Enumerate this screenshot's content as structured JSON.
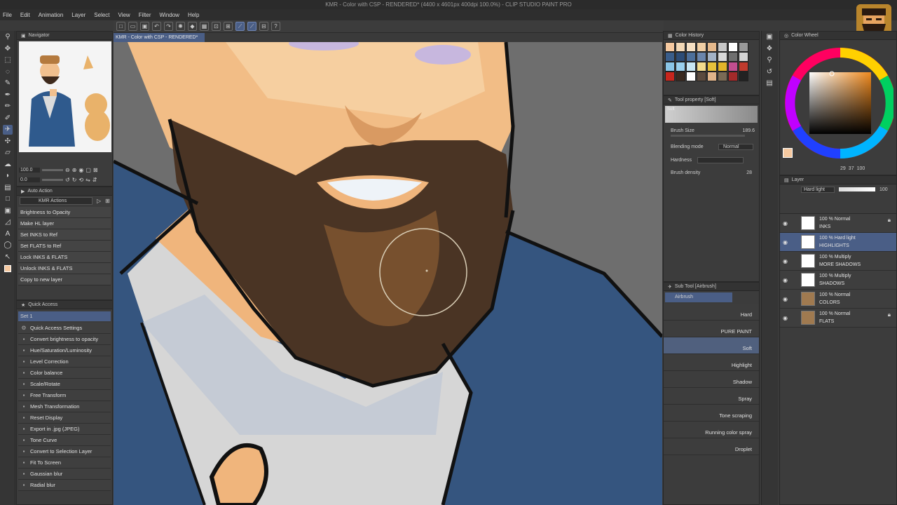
{
  "window": {
    "title": "KMR - Color with CSP - RENDERED* (4400 x 4601px 400dpi 100.0%) - CLIP STUDIO PAINT PRO"
  },
  "menu": [
    "File",
    "Edit",
    "Animation",
    "Layer",
    "Select",
    "View",
    "Filter",
    "Window",
    "Help"
  ],
  "document_tab": "KMR - Color with CSP - RENDERED*",
  "navigator": {
    "title": "Navigator",
    "zoom": "100.0",
    "rotation": "0.0"
  },
  "auto_action": {
    "title": "Auto Action",
    "set": "KMR Actions",
    "items": [
      "Brightness to Opacity",
      "Make HL layer",
      "Set INKS to Ref",
      "Set FLATS to Ref",
      "Lock INKS & FLATS",
      "Unlock INKS & FLATS",
      "Copy to new layer"
    ]
  },
  "quick_access": {
    "title": "Quick Access",
    "set": "Set 1",
    "items": [
      "Quick Access Settings",
      "Convert brightness to opacity",
      "Hue/Saturation/Luminosity",
      "Level Correction",
      "Color balance",
      "Scale/Rotate",
      "Free Transform",
      "Mesh Transformation",
      "Reset Display",
      "Export in .jpg (JPEG)",
      "Tone Curve",
      "Convert to Selection Layer",
      "Fit To Screen",
      "Gaussian blur",
      "Radial blur"
    ]
  },
  "color_history": {
    "title": "Color History",
    "colors": [
      "#f6c9a0",
      "#f3d8b6",
      "#f6e0c4",
      "#f1cfa5",
      "#e5b98c",
      "#c8c8c8",
      "#ffffff",
      "#9a9a9a",
      "#3a5d8a",
      "#2d4c76",
      "#4d6f9a",
      "#6b86ad",
      "#a3b2c6",
      "#d8d8d8",
      "#6f6f6f",
      "#d5d5d5",
      "#8ac5e6",
      "#9ad0ed",
      "#c7e6f3",
      "#f3dc8c",
      "#e6c13b",
      "#e2b42a",
      "#c14e8f",
      "#bf3b2e",
      "#c7261d",
      "#3a2a20",
      "#ffffff",
      "#5a4a3e",
      "#e0b48a",
      "#7a6a55",
      "#a32a2a",
      "#222222"
    ]
  },
  "tool_property": {
    "title": "Tool property [Soft]",
    "preset": "Soft",
    "brush_size_label": "Brush Size",
    "brush_size": "189.6",
    "blending_label": "Blending mode",
    "blending_value": "Normal",
    "hardness_label": "Hardness",
    "density_label": "Brush density",
    "density_value": "28"
  },
  "sub_tool": {
    "title": "Sub Tool [Airbrush]",
    "group": "Airbrush",
    "brushes": [
      "Hard",
      "PURE PAINT",
      "Soft",
      "Highlight",
      "Shadow",
      "Spray",
      "Tone scraping",
      "Running color spray",
      "Droplet"
    ],
    "selected": "Soft"
  },
  "color_wheel": {
    "title": "Color Wheel",
    "current": "#f6c9a0",
    "h": "29",
    "s": "37",
    "v": "100"
  },
  "layers": {
    "title": "Layer",
    "blend": "Hard light",
    "opacity": "100",
    "items": [
      {
        "mode": "100 % Normal",
        "name": "INKS",
        "locked": true,
        "selected": false
      },
      {
        "mode": "100 % Hard light",
        "name": "HIGHLIGHTS",
        "locked": false,
        "selected": true
      },
      {
        "mode": "100 % Multiply",
        "name": "MORE SHADOWS",
        "locked": false,
        "selected": false
      },
      {
        "mode": "100 % Multiply",
        "name": "SHADOWS",
        "locked": false,
        "selected": false
      },
      {
        "mode": "100 % Normal",
        "name": "COLORS",
        "locked": false,
        "selected": false
      },
      {
        "mode": "100 % Normal",
        "name": "FLATS",
        "locked": true,
        "selected": false
      }
    ]
  },
  "icons": [
    "zoom-icon",
    "move-icon",
    "select-icon",
    "lasso-icon",
    "eyedropper-icon",
    "pen-icon",
    "pencil-icon",
    "brush-icon",
    "airbrush-icon",
    "eraser-icon",
    "fill-icon",
    "gradient-icon",
    "shape-icon",
    "text-icon",
    "balloon-icon",
    "ruler-icon"
  ]
}
